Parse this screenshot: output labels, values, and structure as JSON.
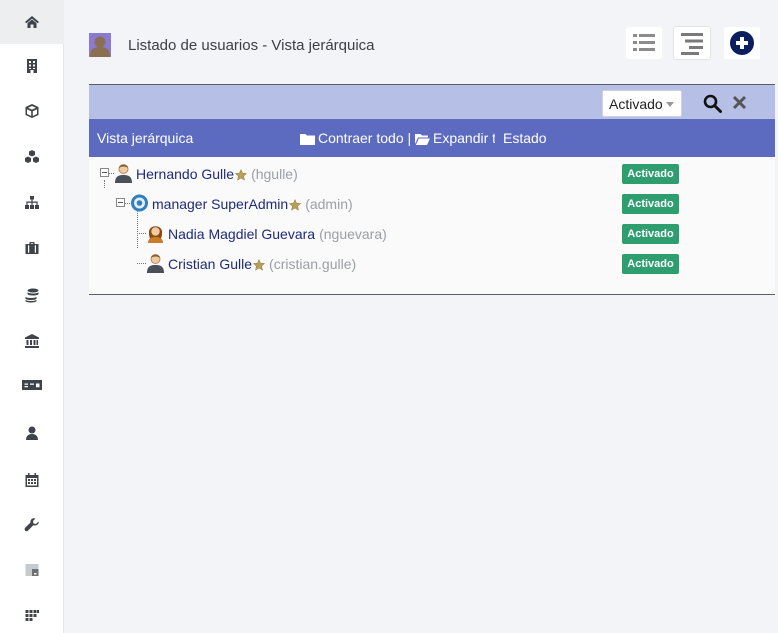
{
  "header": {
    "title": "Listado de usuarios - Vista jerárquica",
    "buttons": [
      {
        "icon": "list-view-icon"
      },
      {
        "icon": "hierarchy-view-icon"
      },
      {
        "icon": "add-circle-icon"
      }
    ]
  },
  "sidebar": {
    "items": [
      {
        "icon": "home-icon",
        "active": true
      },
      {
        "icon": "building-icon"
      },
      {
        "icon": "cube-icon"
      },
      {
        "icon": "cubes-icon"
      },
      {
        "icon": "sitemap-icon"
      },
      {
        "icon": "briefcase-icon"
      },
      {
        "icon": "database-icon"
      },
      {
        "icon": "bank-icon"
      },
      {
        "icon": "money-bill-icon"
      },
      {
        "icon": "user-tie-icon"
      },
      {
        "icon": "calendar-icon"
      },
      {
        "icon": "wrench-icon"
      },
      {
        "icon": "chart-box-icon"
      },
      {
        "icon": "grid-icon"
      }
    ]
  },
  "filter": {
    "status_value": "Activado"
  },
  "columns": {
    "view": "Vista jerárquica",
    "collapse_all": "Contraer todo |",
    "expand_all": "Expandir todo",
    "status": "Estado"
  },
  "tree": [
    {
      "name": "Hernando Gulle",
      "login": "(hgulle)",
      "status": "Activado",
      "avatar": "male-user-icon",
      "starred": true
    },
    {
      "name": "manager SuperAdmin",
      "login": "(admin)",
      "status": "Activado",
      "avatar": "admin-gear-icon",
      "starred": true
    },
    {
      "name": "Nadia Magdiel Guevara",
      "login": "(nguevara)",
      "status": "Activado",
      "avatar": "female-user-icon",
      "starred": false
    },
    {
      "name": "Cristian Gulle",
      "login": "(cristian.gulle)",
      "status": "Activado",
      "avatar": "male-user-icon",
      "starred": true
    }
  ],
  "colors": {
    "filter_bar": "#b6bfe5",
    "column_header": "#5c6bc0",
    "badge_active": "#2e9e6f",
    "user_link": "#1e2a78"
  }
}
